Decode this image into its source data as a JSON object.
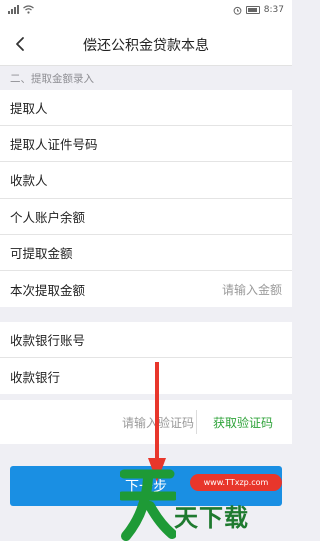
{
  "status_bar": {
    "carrier_icon": "signal-icon",
    "wifi_icon": "wifi-icon",
    "time": "8:37"
  },
  "nav": {
    "back_icon": "chevron-left-icon",
    "title": "偿还公积金贷款本息"
  },
  "section": {
    "header": "二、提取金额录入"
  },
  "fields": [
    {
      "label": "提取人",
      "value": ""
    },
    {
      "label": "提取人证件号码",
      "value": ""
    },
    {
      "label": "收款人",
      "value": ""
    },
    {
      "label": "个人账户余额",
      "value": ""
    },
    {
      "label": "可提取金额",
      "value": ""
    },
    {
      "label": "本次提取金额",
      "placeholder": "请输入金额"
    }
  ],
  "bank_fields": [
    {
      "label": "收款银行账号",
      "value": ""
    },
    {
      "label": "收款银行",
      "value": ""
    }
  ],
  "verification": {
    "placeholder": "请输入验证码",
    "get_code_label": "获取验证码"
  },
  "footer": {
    "next_label": "下一步"
  },
  "watermark": {
    "site": "www.TTxzp.com",
    "brand": "天下载"
  },
  "colors": {
    "accent_blue": "#1a8fe3",
    "accent_green": "#2fa33a",
    "arrow_red": "#e8362b"
  }
}
